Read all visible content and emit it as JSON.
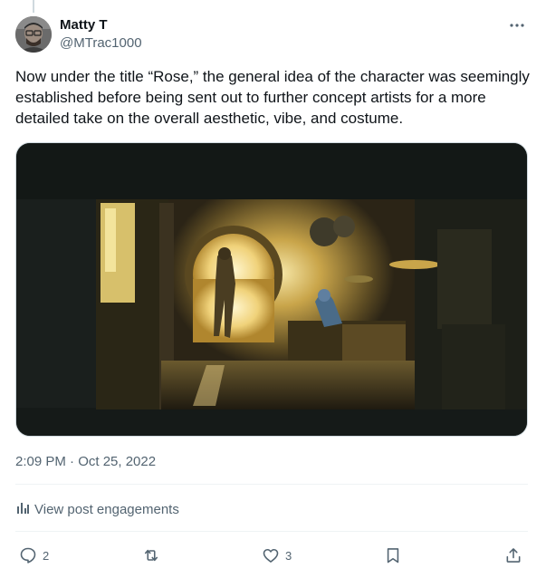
{
  "author": {
    "name": "Matty T",
    "handle": "@MTrac1000"
  },
  "post": {
    "text": "Now under the title “Rose,” the general idea of the character was seemingly established before being sent out to further concept artists for a more detailed take on the overall aesthetic, vibe, and costume.",
    "timestamp": "2:09 PM · Oct 25, 2022",
    "engagements_label": "View post engagements"
  },
  "stats": {
    "replies": "2",
    "likes": "3"
  },
  "icons": {
    "more": "more-icon",
    "analytics": "bar-chart-icon",
    "reply": "reply-icon",
    "repost": "repost-icon",
    "like": "heart-icon",
    "bookmark": "bookmark-icon",
    "share": "share-icon"
  },
  "colors": {
    "text_primary": "#0f1419",
    "text_secondary": "#536471",
    "border": "#cfd9de"
  }
}
